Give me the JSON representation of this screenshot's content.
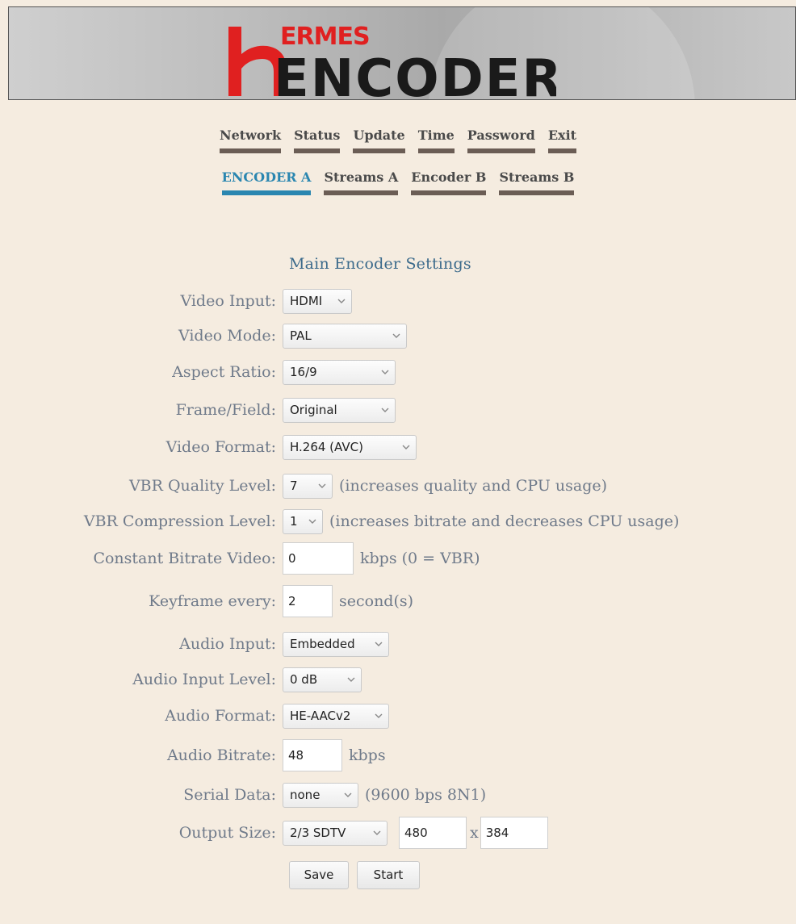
{
  "brand": {
    "small": "ERMES",
    "big": "ENCODER",
    "accent_color": "#e02020"
  },
  "nav": {
    "row1": [
      "Network",
      "Status",
      "Update",
      "Time",
      "Password",
      "Exit"
    ],
    "row2": [
      "ENCODER A",
      "Streams A",
      "Encoder B",
      "Streams B"
    ],
    "active": "ENCODER A"
  },
  "form": {
    "title": "Main Encoder Settings",
    "video_input": {
      "label": "Video Input:",
      "value": "HDMI"
    },
    "video_mode": {
      "label": "Video Mode:",
      "value": "PAL"
    },
    "aspect_ratio": {
      "label": "Aspect Ratio:",
      "value": "16/9"
    },
    "frame_field": {
      "label": "Frame/Field:",
      "value": "Original"
    },
    "video_format": {
      "label": "Video Format:",
      "value": "H.264 (AVC)"
    },
    "vbr_quality": {
      "label": "VBR Quality Level:",
      "value": "7",
      "note": "(increases quality and CPU usage)"
    },
    "vbr_compression": {
      "label": "VBR Compression Level:",
      "value": "1",
      "note": "(increases bitrate and decreases CPU usage)"
    },
    "cbr_video": {
      "label": "Constant Bitrate Video:",
      "value": "0",
      "note": "kbps (0 = VBR)"
    },
    "keyframe": {
      "label": "Keyframe every:",
      "value": "2",
      "note": "second(s)"
    },
    "audio_input": {
      "label": "Audio Input:",
      "value": "Embedded"
    },
    "audio_level": {
      "label": "Audio Input Level:",
      "value": "0 dB"
    },
    "audio_format": {
      "label": "Audio Format:",
      "value": "HE-AACv2"
    },
    "audio_bitrate": {
      "label": "Audio Bitrate:",
      "value": "48",
      "note": "kbps"
    },
    "serial_data": {
      "label": "Serial Data:",
      "value": "none",
      "note": "(9600 bps 8N1)"
    },
    "output_size": {
      "label": "Output Size:",
      "value": "2/3 SDTV",
      "width": "480",
      "separator": "x",
      "height": "384"
    },
    "save_label": "Save",
    "start_label": "Start"
  }
}
